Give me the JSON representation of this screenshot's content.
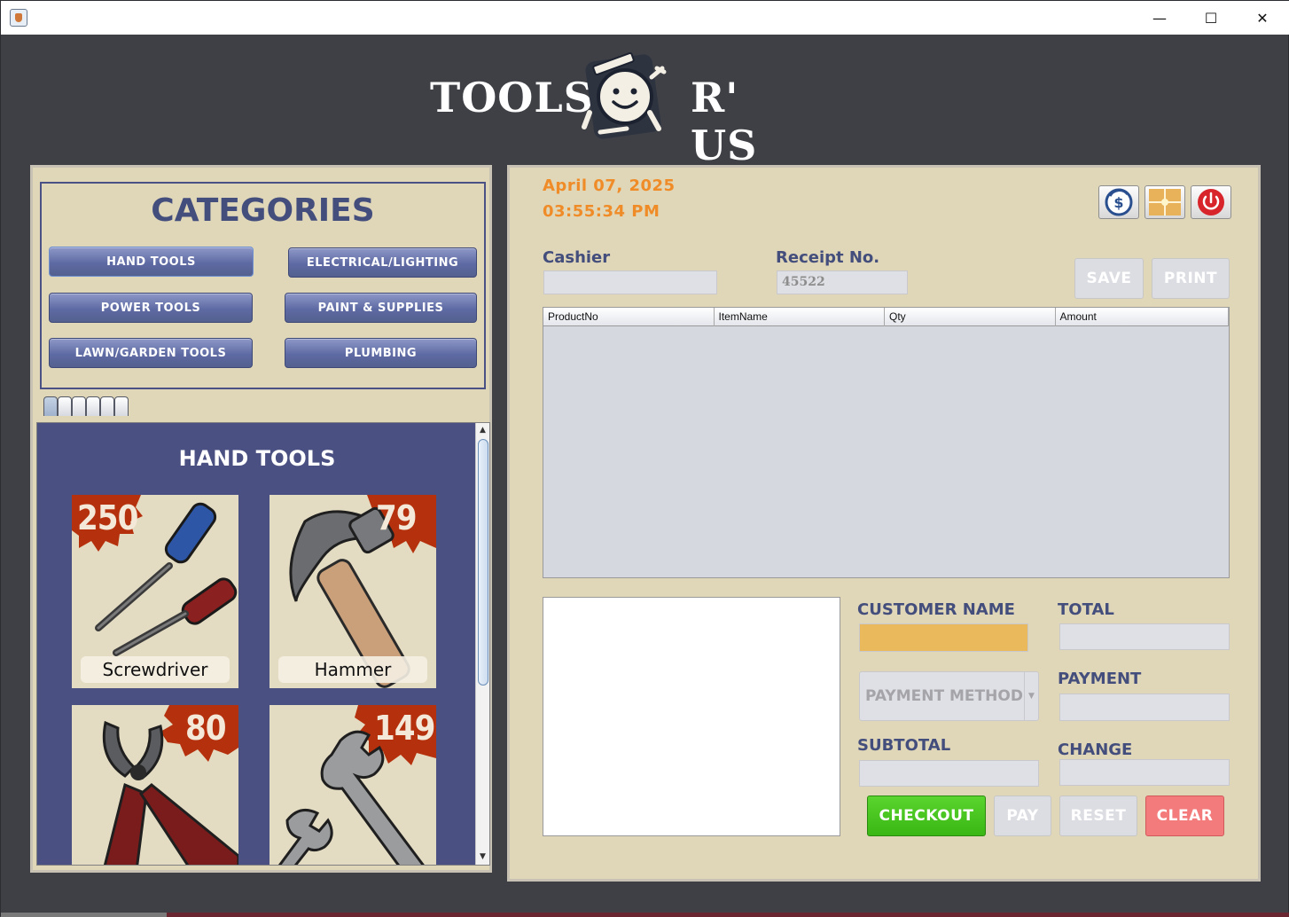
{
  "window": {
    "minimize_glyph": "—",
    "maximize_glyph": "☐",
    "close_glyph": "✕"
  },
  "logo": {
    "left_text": "TOOLS",
    "right_text": "R' US",
    "icon": "smiley-tools-logo-icon"
  },
  "categories": {
    "title": "CATEGORIES",
    "buttons": [
      "HAND TOOLS",
      "ELECTRICAL/LIGHTING",
      "POWER TOOLS",
      "PAINT & SUPPLIES",
      "LAWN/GARDEN TOOLS",
      "PLUMBING"
    ],
    "tab_count": 6
  },
  "products": {
    "title": "HAND TOOLS",
    "items": [
      {
        "price": "250",
        "label": "Screwdriver",
        "icon": "screwdriver-icon"
      },
      {
        "price": "79",
        "label": "Hammer",
        "icon": "hammer-icon"
      },
      {
        "price": "80",
        "label": "",
        "icon": "pliers-icon"
      },
      {
        "price": "149",
        "label": "",
        "icon": "wrench-icon"
      }
    ]
  },
  "header": {
    "date": "April 07, 2025",
    "time": "03:55:34 PM",
    "icons": [
      "refund-dollar-icon",
      "inventory-box-icon",
      "power-off-icon"
    ]
  },
  "form": {
    "cashier_label": "Cashier",
    "cashier_value": "",
    "receipt_label": "Receipt No.",
    "receipt_value": "45522",
    "save_label": "SAVE",
    "print_label": "PRINT"
  },
  "table": {
    "columns": [
      "ProductNo",
      "ItemName",
      "Qty",
      "Amount"
    ],
    "rows": []
  },
  "checkout": {
    "customer_name_label": "CUSTOMER NAME",
    "customer_name_value": "",
    "total_label": "TOTAL",
    "payment_label": "PAYMENT",
    "payment_method_placeholder": "PAYMENT METHOD",
    "subtotal_label": "SUBTOTAL",
    "change_label": "CHANGE",
    "checkout_btn": "CHECKOUT",
    "pay_btn": "PAY",
    "reset_btn": "RESET",
    "clear_btn": "CLEAR"
  },
  "colors": {
    "background": "#3e4046",
    "panel": "#e0d6b8",
    "accent_navy": "#434e7c",
    "date_orange": "#f08c28",
    "checkout_green": "#3ab714",
    "clear_red": "#f47b7b",
    "customer_field": "#e9b95c"
  }
}
